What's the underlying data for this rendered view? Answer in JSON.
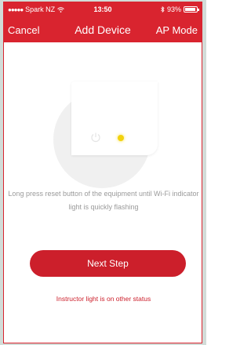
{
  "status_bar": {
    "signal_dots": "●●●●●",
    "carrier": "Spark NZ",
    "wifi_icon": "wifi-icon",
    "time": "13:50",
    "bluetooth_icon": "bluetooth-icon",
    "battery_percent": "93%",
    "battery_level": 0.93
  },
  "nav": {
    "cancel_label": "Cancel",
    "title": "Add Device",
    "mode_label": "AP Mode"
  },
  "illustration": {
    "power_icon": "power-icon",
    "indicator_color": "#f2d20e"
  },
  "main": {
    "instruction": "Long press reset button of the equipment  until Wi-Fi indicator light is quickly flashing",
    "next_button_label": "Next Step",
    "alt_status_link": "Instructor light is on other status"
  },
  "colors": {
    "accent": "#d9242f",
    "button": "#cc1f2b",
    "muted_text": "#9a9a9a"
  }
}
